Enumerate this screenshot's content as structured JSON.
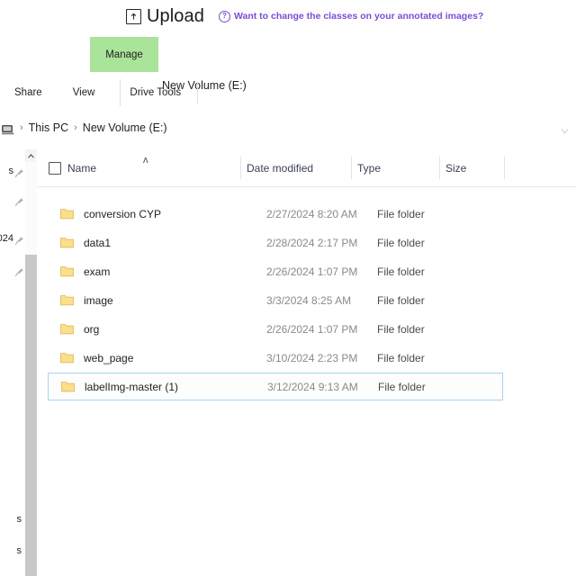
{
  "banner": {
    "upload_icon": "upload-icon",
    "upload_label": "Upload",
    "help_icon": "question-circle-icon",
    "hint_text": "Want to change the classes on your annotated images?",
    "hint_color": "#7a4ed6"
  },
  "ribbon": {
    "contextual_tab": "Manage",
    "contextual_tab_color": "#aae39a",
    "contextual_group": "Drive Tools",
    "volume_title": "New Volume (E:)",
    "tabs": [
      "Share",
      "View",
      "Drive Tools"
    ]
  },
  "address_bar": {
    "computer_icon": "this-pc-icon",
    "crumbs": [
      "This PC",
      "New Volume (E:)"
    ],
    "separator": "›",
    "dropdown_icon": "chevron-down-icon"
  },
  "nav_pane": {
    "clipped_labels": [
      "s",
      "",
      "024",
      ""
    ],
    "pin_icon": "pin-icon",
    "lower_labels": [
      "s",
      "s"
    ],
    "scroll_up_icon": "caret-up-icon"
  },
  "columns": {
    "select_all": "select-all-checkbox",
    "name": "Name",
    "sort_indicator": "ʌ",
    "date_modified": "Date modified",
    "type": "Type",
    "size": "Size"
  },
  "files": [
    {
      "name": "conversion CYP",
      "date": "2/27/2024 8:20 AM",
      "type": "File folder",
      "size": "",
      "selected": false
    },
    {
      "name": "data1",
      "date": "2/28/2024 2:17 PM",
      "type": "File folder",
      "size": "",
      "selected": false
    },
    {
      "name": "exam",
      "date": "2/26/2024 1:07 PM",
      "type": "File folder",
      "size": "",
      "selected": false
    },
    {
      "name": "image",
      "date": "3/3/2024 8:25 AM",
      "type": "File folder",
      "size": "",
      "selected": false
    },
    {
      "name": "org",
      "date": "2/26/2024 1:07 PM",
      "type": "File folder",
      "size": "",
      "selected": false
    },
    {
      "name": "web_page",
      "date": "3/10/2024 2:23 PM",
      "type": "File folder",
      "size": "",
      "selected": false
    },
    {
      "name": "labelImg-master (1)",
      "date": "3/12/2024 9:13 AM",
      "type": "File folder",
      "size": "",
      "selected": true
    }
  ],
  "theme": {
    "folder_fill": "#fcdf8a",
    "selection_border": "#a8d3f0",
    "header_text": "#3a3f55"
  }
}
